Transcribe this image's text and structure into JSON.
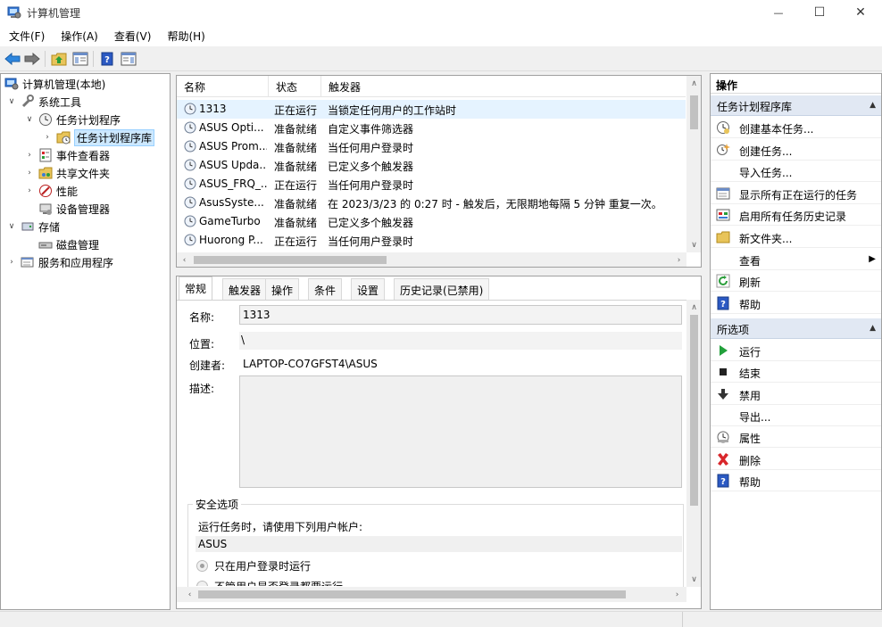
{
  "window": {
    "title": "计算机管理",
    "minimize_glyph": "—",
    "maximize_glyph": "☐",
    "close_glyph": "✕"
  },
  "menu": [
    "文件(F)",
    "操作(A)",
    "查看(V)",
    "帮助(H)"
  ],
  "tree": {
    "root": "计算机管理(本地)",
    "system_tools": "系统工具",
    "task_scheduler": "任务计划程序",
    "task_scheduler_library": "任务计划程序库",
    "event_viewer": "事件查看器",
    "shared_folders": "共享文件夹",
    "performance": "性能",
    "device_manager": "设备管理器",
    "storage": "存储",
    "disk_management": "磁盘管理",
    "services_apps": "服务和应用程序"
  },
  "task_list": {
    "columns": [
      "名称",
      "状态",
      "触发器"
    ],
    "rows": [
      {
        "name": "1313",
        "status": "正在运行",
        "trigger": "当锁定任何用户的工作站时"
      },
      {
        "name": "ASUS Opti...",
        "status": "准备就绪",
        "trigger": "自定义事件筛选器"
      },
      {
        "name": "ASUS Prom...",
        "status": "准备就绪",
        "trigger": "当任何用户登录时"
      },
      {
        "name": "ASUS Upda...",
        "status": "准备就绪",
        "trigger": "已定义多个触发器"
      },
      {
        "name": "ASUS_FRQ_...",
        "status": "正在运行",
        "trigger": "当任何用户登录时"
      },
      {
        "name": "AsusSyste...",
        "status": "准备就绪",
        "trigger": "在 2023/3/23 的 0:27 时 - 触发后，无限期地每隔 5 分钟 重复一次。"
      },
      {
        "name": "GameTurbo",
        "status": "准备就绪",
        "trigger": "已定义多个触发器"
      },
      {
        "name": "Huorong P...",
        "status": "正在运行",
        "trigger": "当任何用户登录时"
      }
    ]
  },
  "detail": {
    "tabs": [
      "常规",
      "触发器",
      "操作",
      "条件",
      "设置",
      "历史记录(已禁用)"
    ],
    "name_label": "名称:",
    "name_value": "1313",
    "location_label": "位置:",
    "location_value": "\\",
    "author_label": "创建者:",
    "author_value": "LAPTOP-CO7GFST4\\ASUS",
    "description_label": "描述:",
    "security_title": "安全选项",
    "run_as_text": "运行任务时，请使用下列用户帐户:",
    "user_account": "ASUS",
    "radio1": "只在用户登录时运行",
    "radio2": "不管用户是否登录都要运行"
  },
  "actions": {
    "header": "操作",
    "section1": "任务计划程序库",
    "items1": [
      "创建基本任务...",
      "创建任务...",
      "导入任务...",
      "显示所有正在运行的任务",
      "启用所有任务历史记录",
      "新文件夹...",
      "查看",
      "刷新",
      "帮助"
    ],
    "section2": "所选项",
    "items2": [
      "运行",
      "结束",
      "禁用",
      "导出...",
      "属性",
      "删除",
      "帮助"
    ]
  },
  "colors": {
    "selection": "#cce8ff",
    "row_selected": "#e5f3ff",
    "section_header": "#e1e8f3",
    "run_green": "#22a03b",
    "delete_red": "#d9262b",
    "help_blue": "#2b59c3"
  }
}
